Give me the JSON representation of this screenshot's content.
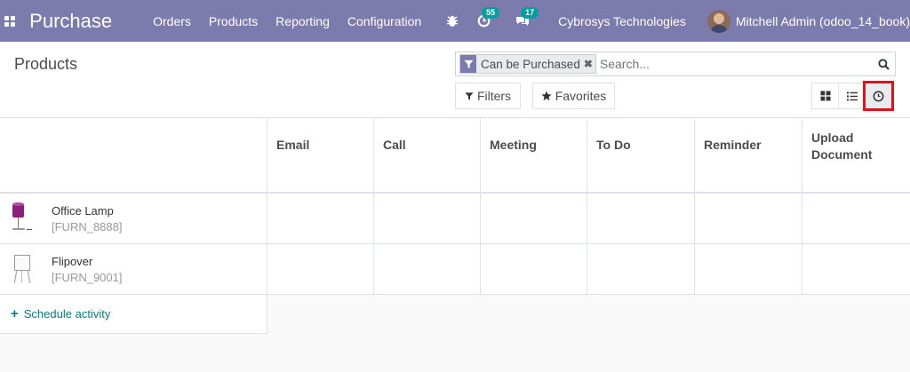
{
  "navbar": {
    "app_name": "Purchase",
    "menu": [
      "Orders",
      "Products",
      "Reporting",
      "Configuration"
    ],
    "activity_badge": "55",
    "messages_badge": "17",
    "company": "Cybrosys Technologies",
    "user": "Mitchell Admin (odoo_14_book)"
  },
  "control_panel": {
    "breadcrumb": "Products",
    "search": {
      "facet_label": "Can be Purchased",
      "facet_remove": "✖",
      "placeholder": "Search..."
    },
    "filters_label": "Filters",
    "favorites_label": "Favorites",
    "views": [
      "kanban",
      "list",
      "activity"
    ],
    "active_view": "activity"
  },
  "grid": {
    "columns": [
      "Email",
      "Call",
      "Meeting",
      "To Do",
      "Reminder",
      "Upload Document"
    ],
    "rows": [
      {
        "name": "Office Lamp",
        "ref": "[FURN_8888]",
        "image": "lamp"
      },
      {
        "name": "Flipover",
        "ref": "[FURN_9001]",
        "image": "flipover"
      }
    ],
    "schedule_label": "Schedule activity"
  },
  "colors": {
    "navbar": "#7c7bad",
    "accent": "#017e84",
    "highlight": "#e0111b",
    "badge": "#00a09d"
  }
}
